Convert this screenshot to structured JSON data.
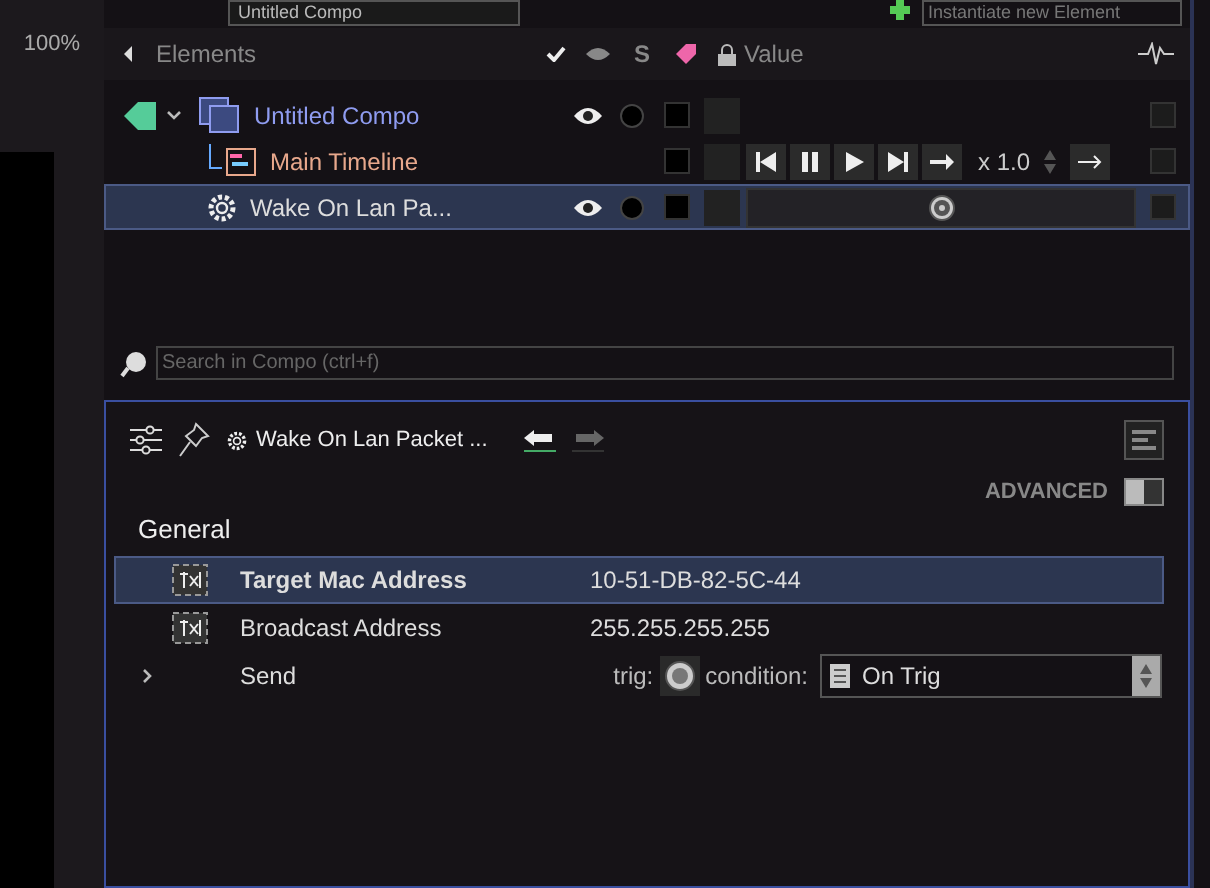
{
  "toolbar": {
    "compo_select": "Untitled Compo",
    "new_element": {
      "placeholder": "Instantiate new Element"
    }
  },
  "zoom": "100%",
  "elements": {
    "header": "Elements",
    "columns": [
      "S",
      "Value"
    ],
    "rows": [
      {
        "kind": "compo",
        "name": "Untitled Compo",
        "expanded": true,
        "visible": true,
        "selected": false,
        "children": [
          {
            "kind": "timeline",
            "name": "Main Timeline",
            "speed": "x 1.0",
            "selected": false
          },
          {
            "kind": "module",
            "name": "Wake On Lan Pa...",
            "visible": true,
            "selected": true
          }
        ]
      }
    ],
    "search": {
      "placeholder": "Search in Compo (ctrl+f)"
    }
  },
  "inspector": {
    "title": "Wake On Lan Packet ...",
    "advanced": {
      "label": "ADVANCED",
      "on": false
    },
    "section": "General",
    "params": [
      {
        "kind": "text",
        "name": "Target Mac Address",
        "value": "10-51-DB-82-5C-44",
        "selected": true
      },
      {
        "kind": "text",
        "name": "Broadcast Address",
        "value": "255.255.255.255",
        "selected": false
      },
      {
        "kind": "trigger",
        "name": "Send",
        "trig_label": "trig:",
        "condition_label": "condition:",
        "condition": "On Trig",
        "selected": false
      }
    ]
  }
}
